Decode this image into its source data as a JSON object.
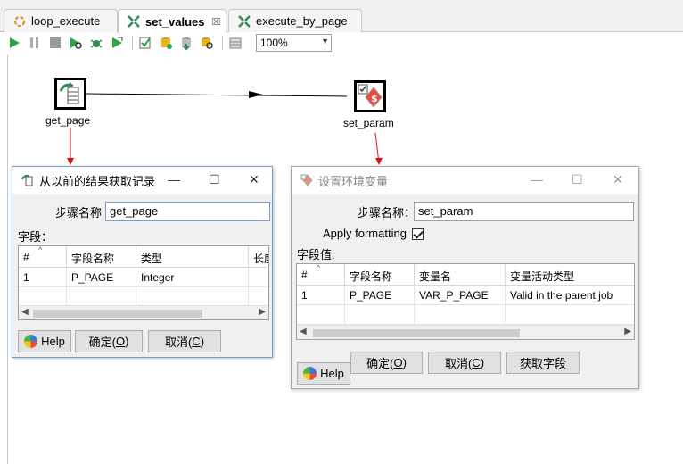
{
  "tabs": [
    {
      "label": "loop_execute",
      "icon": "transformation-loop-icon"
    },
    {
      "label": "set_values",
      "icon": "transformation-icon",
      "close": "☒"
    },
    {
      "label": "execute_by_page",
      "icon": "transformation-icon"
    }
  ],
  "toolbar": {
    "zoom": "100%"
  },
  "canvas": {
    "steps": [
      {
        "label": "get_page",
        "icon": "rows-from-result-icon"
      },
      {
        "label": "set_param",
        "icon": "set-variables-icon"
      }
    ]
  },
  "dialog1": {
    "title": "从以前的结果获取记录",
    "step_name_label": "步骤名称",
    "step_name_value": "get_page",
    "fields_label": "字段：",
    "columns": [
      "#",
      "字段名称",
      "类型",
      "长度"
    ],
    "rows": [
      [
        "1",
        "P_PAGE",
        "Integer",
        ""
      ]
    ],
    "help": "Help",
    "ok_pre": "确定(",
    "ok_key": "O",
    "ok_post": ")",
    "cancel_pre": "取消(",
    "cancel_key": "C",
    "cancel_post": ")"
  },
  "dialog2": {
    "title": "设置环境变量",
    "step_name_label": "步骤名称：",
    "step_name_value": "set_param",
    "apply_formatting_label": "Apply formatting",
    "apply_formatting_checked": true,
    "fields_label": "字段值:",
    "columns": [
      "#",
      "字段名称",
      "变量名",
      "变量活动类型"
    ],
    "rows": [
      [
        "1",
        "P_PAGE",
        "VAR_P_PAGE",
        "Valid in the parent job"
      ]
    ],
    "help": "Help",
    "ok_pre": "确定(",
    "ok_key": "O",
    "ok_post": ")",
    "cancel_pre": "取消(",
    "cancel_key": "C",
    "cancel_post": ")",
    "get_fields_pre": "",
    "get_fields_key": "获",
    "get_fields_post": "取字段"
  }
}
